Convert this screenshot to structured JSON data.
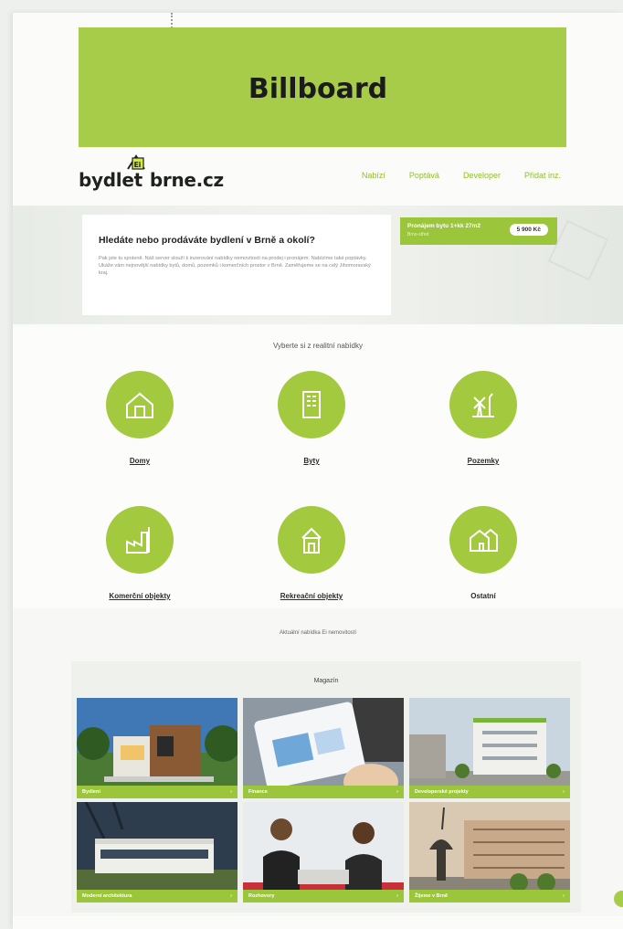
{
  "billboard": {
    "label": "Billboard"
  },
  "site": {
    "logo_left": "bydlet",
    "logo_mark": "Ei",
    "logo_right": "brne.cz",
    "nav": [
      "Nabízí",
      "Poptává",
      "Developer",
      "Přidat inz."
    ]
  },
  "hero": {
    "heading": "Hledáte nebo prodáváte bydlení v Brně a okolí?",
    "body": "Pak jste tu správně. Náš server slouží k inzerování nabídky nemovitostí na prodej i pronájem. Nabízíme také poptávky. Ukáže vám nejnovější nabídky bytů, domů, pozemků i komerčních prostor v Brně. Zaměřujeme se na celý Jihomoravský kraj.",
    "offer_title": "Pronájem bytu 1+kk 27m2",
    "offer_sub": "Brno-střed",
    "offer_price": "5 900 Kč"
  },
  "categories": {
    "title": "Vyberte si z realitní nabídky",
    "items": [
      {
        "label": "Domy",
        "icon": "house-icon"
      },
      {
        "label": "Byty",
        "icon": "apartment-building-icon"
      },
      {
        "label": "Pozemky",
        "icon": "land-windmill-icon"
      },
      {
        "label": "Komerční objekty",
        "icon": "factory-icon"
      },
      {
        "label": "Rekreační objekty",
        "icon": "cottage-icon"
      },
      {
        "label": "Ostatní",
        "icon": "outline-house-icon"
      }
    ]
  },
  "news": {
    "title": "Aktuální nabídka Ei nemovitostí",
    "magazine_title": "Magazín",
    "tiles": [
      {
        "label": "Bydlení"
      },
      {
        "label": "Finance"
      },
      {
        "label": "Developerské projekty"
      },
      {
        "label": "Moderní architektura"
      },
      {
        "label": "Rozhovory"
      },
      {
        "label": "Žijeme v Brně"
      }
    ]
  },
  "colors": {
    "accent": "#a7cc4a",
    "accent_dark": "#9bc63c"
  }
}
